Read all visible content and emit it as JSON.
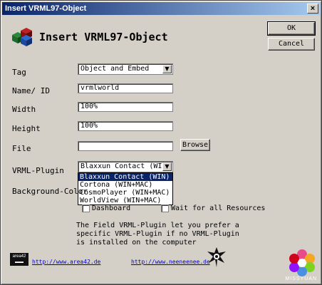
{
  "window": {
    "title": "Insert VRML97-Object",
    "close_glyph": "×"
  },
  "heading": "Insert VRML97-Object",
  "buttons": {
    "ok": "OK",
    "cancel": "Cancel",
    "browse": "Browse"
  },
  "fields": {
    "tag": {
      "label": "Tag",
      "value": "Object and Embed"
    },
    "name_id": {
      "label": "Name/ ID",
      "value": "vrmlworld"
    },
    "width": {
      "label": "Width",
      "value": "100%"
    },
    "height": {
      "label": "Height",
      "value": "100%"
    },
    "file": {
      "label": "File",
      "value": ""
    },
    "vrml_plugin": {
      "label": "VRML-Plugin",
      "value": "Blaxxun Contact (WIN)"
    },
    "background_color": {
      "label": "Background-Color"
    }
  },
  "plugin_options": [
    "Blaxxun Contact (WIN)",
    "Cortona (WIN+MAC)",
    "CosmoPlayer (WIN+MAC)",
    "WorldView (WIN+MAC)"
  ],
  "checkboxes": {
    "dashboard": "Dashboard",
    "wait": "Wait for all Resources"
  },
  "note": "The Field VRML-Plugin let you prefer a specific VRML-Plugin if no VRML-Plugin is installed on the computer",
  "links": {
    "area42": "http://www.area42.de",
    "neeneenee": "http://www.neeneenee.de"
  },
  "logos": {
    "area42": "area42",
    "watermark": "MISSYUAN"
  },
  "colors": {
    "titlebar_start": "#0a246a",
    "titlebar_end": "#a6caf0",
    "dialog_bg": "#d4d0c8",
    "selection": "#0a246a",
    "link": "#0000cc"
  },
  "icons": [
    "cubes-logo-icon",
    "dropdown-arrow-icon",
    "close-icon",
    "area42-logo-icon",
    "jester-logo-icon"
  ]
}
